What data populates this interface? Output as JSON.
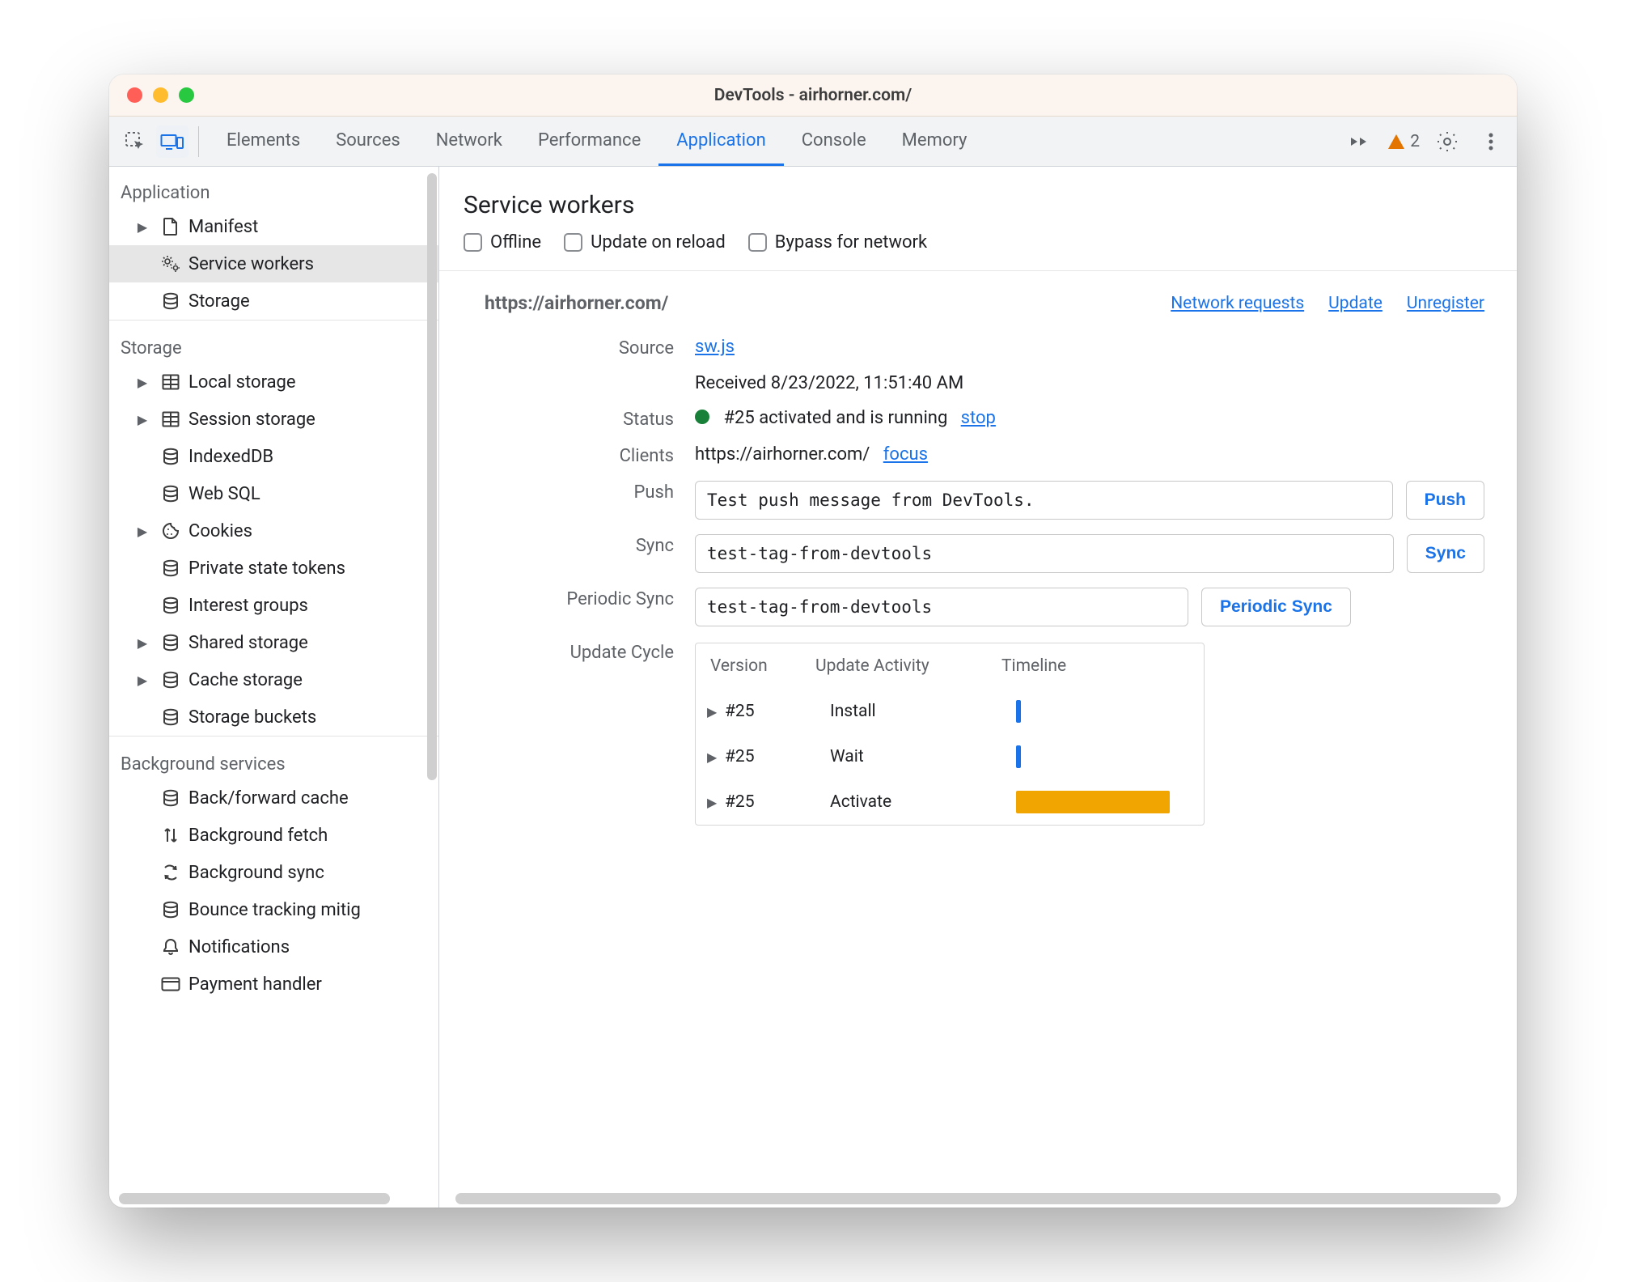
{
  "window_title": "DevTools - airhorner.com/",
  "toolbar": {
    "tabs": [
      "Elements",
      "Sources",
      "Network",
      "Performance",
      "Application",
      "Console",
      "Memory"
    ],
    "active_tab_index": 4,
    "warning_count": "2"
  },
  "sidebar": {
    "sections": [
      {
        "title": "Application",
        "items": [
          {
            "icon": "file-icon",
            "arrow": true,
            "label": "Manifest"
          },
          {
            "icon": "gears-icon",
            "arrow": false,
            "label": "Service workers",
            "selected": true
          },
          {
            "icon": "database-icon",
            "arrow": false,
            "label": "Storage"
          }
        ]
      },
      {
        "title": "Storage",
        "items": [
          {
            "icon": "table-icon",
            "arrow": true,
            "label": "Local storage"
          },
          {
            "icon": "table-icon",
            "arrow": true,
            "label": "Session storage"
          },
          {
            "icon": "database-icon",
            "arrow": false,
            "label": "IndexedDB"
          },
          {
            "icon": "database-icon",
            "arrow": false,
            "label": "Web SQL"
          },
          {
            "icon": "cookie-icon",
            "arrow": true,
            "label": "Cookies"
          },
          {
            "icon": "database-icon",
            "arrow": false,
            "label": "Private state tokens"
          },
          {
            "icon": "database-icon",
            "arrow": false,
            "label": "Interest groups"
          },
          {
            "icon": "database-icon",
            "arrow": true,
            "label": "Shared storage"
          },
          {
            "icon": "database-icon",
            "arrow": true,
            "label": "Cache storage"
          },
          {
            "icon": "database-icon",
            "arrow": false,
            "label": "Storage buckets"
          }
        ]
      },
      {
        "title": "Background services",
        "items": [
          {
            "icon": "database-icon",
            "arrow": false,
            "label": "Back/forward cache"
          },
          {
            "icon": "arrows-icon",
            "arrow": false,
            "label": "Background fetch"
          },
          {
            "icon": "sync-icon",
            "arrow": false,
            "label": "Background sync"
          },
          {
            "icon": "database-icon",
            "arrow": false,
            "label": "Bounce tracking mitig"
          },
          {
            "icon": "bell-icon",
            "arrow": false,
            "label": "Notifications"
          },
          {
            "icon": "card-icon",
            "arrow": false,
            "label": "Payment handler"
          }
        ]
      }
    ]
  },
  "main": {
    "title": "Service workers",
    "options": {
      "offline": "Offline",
      "update_on_reload": "Update on reload",
      "bypass_for_network": "Bypass for network"
    },
    "origin": "https://airhorner.com/",
    "origin_actions": {
      "network_requests": "Network requests",
      "update": "Update",
      "unregister": "Unregister"
    },
    "labels": {
      "source": "Source",
      "status": "Status",
      "clients": "Clients",
      "push": "Push",
      "sync": "Sync",
      "periodic_sync": "Periodic Sync",
      "update_cycle": "Update Cycle"
    },
    "source": {
      "file": "sw.js",
      "received": "Received 8/23/2022, 11:51:40 AM"
    },
    "status": {
      "text": "#25 activated and is running",
      "action": "stop"
    },
    "clients": {
      "url": "https://airhorner.com/",
      "action": "focus"
    },
    "push": {
      "value": "Test push message from DevTools.",
      "button": "Push"
    },
    "sync": {
      "value": "test-tag-from-devtools",
      "button": "Sync"
    },
    "periodic_sync": {
      "value": "test-tag-from-devtools",
      "button": "Periodic Sync"
    },
    "update_cycle": {
      "cols": {
        "version": "Version",
        "activity": "Update Activity",
        "timeline": "Timeline"
      },
      "rows": [
        {
          "version": "#25",
          "activity": "Install",
          "bar": "tiny"
        },
        {
          "version": "#25",
          "activity": "Wait",
          "bar": "tiny"
        },
        {
          "version": "#25",
          "activity": "Activate",
          "bar": "wide"
        }
      ]
    }
  },
  "icons_svg": {
    "file-icon": "<svg width='20' height='22' viewBox='0 0 20 22' fill='none' stroke='currentColor' stroke-width='2'><path d='M3 1h9l5 5v14a1 1 0 0 1-1 1H3a1 1 0 0 1-1-1V2a1 1 0 0 1 1-1Z'/><path d='M12 1v5h5'/></svg>",
    "gears-icon": "<svg width='24' height='22' viewBox='0 0 24 22' fill='none' stroke='currentColor' stroke-width='1.6'><circle cx='8' cy='8' r='3'/><path d='M8 3v-2M8 15v-2M3 8h-2M15 8h-2M4.5 4.5 3 3M13 13l-1.5-1.5M4.5 11.5 3 13M13 3l-1.5 1.5'/><circle cx='18' cy='16' r='2.5'/><path d='M18 12v-1.5M18 21v-1.5M14 16h-1.5M23 16h-1.5'/></svg>",
    "database-icon": "<svg width='22' height='22' viewBox='0 0 22 22' fill='none' stroke='currentColor' stroke-width='2'><ellipse cx='11' cy='5' rx='8' ry='3.2'/><path d='M3 5v12c0 1.8 3.6 3.2 8 3.2s8-1.4 8-3.2V5'/><path d='M3 11c0 1.8 3.6 3.2 8 3.2s8-1.4 8-3.2'/></svg>",
    "table-icon": "<svg width='22' height='20' viewBox='0 0 22 20' fill='none' stroke='currentColor' stroke-width='2'><rect x='1.5' y='1.5' width='19' height='17' rx='1'/><path d='M1.5 7h19M1.5 13h19M11 1.5v17'/></svg>",
    "cookie-icon": "<svg width='22' height='22' viewBox='0 0 22 22' fill='none' stroke='currentColor' stroke-width='2'><path d='M11 2a9 9 0 1 0 9 9 5 5 0 0 1-5-4 5 5 0 0 1-4-5Z'/><circle cx='8' cy='9' r='1' fill='currentColor' stroke='none'/><circle cx='12' cy='15' r='1' fill='currentColor' stroke='none'/><circle cx='7' cy='15' r='1' fill='currentColor' stroke='none'/></svg>",
    "arrows-icon": "<svg width='22' height='22' viewBox='0 0 22 22' fill='none' stroke='currentColor' stroke-width='2'><path d='M7 3v16M7 3 4 6M7 3l3 3'/><path d='M15 19V3M15 19l-3-3M15 19l3-3'/></svg>",
    "sync-icon": "<svg width='22' height='22' viewBox='0 0 22 22' fill='none' stroke='currentColor' stroke-width='2'><path d='M4 5a8 8 0 0 1 13 2'/><path d='m17 3 .5 4-4-.5'/><path d='M18 17a8 8 0 0 1-13-2'/><path d='m5 19-.5-4 4 .5'/></svg>",
    "bell-icon": "<svg width='20' height='22' viewBox='0 0 20 22' fill='none' stroke='currentColor' stroke-width='2'><path d='M10 2a6 6 0 0 1 6 6v4l2 3v1H2v-1l2-3V8a6 6 0 0 1 6-6Z'/><path d='M8 18a2 2 0 0 0 4 0'/></svg>",
    "card-icon": "<svg width='24' height='18' viewBox='0 0 24 18' fill='none' stroke='currentColor' stroke-width='2'><rect x='1.5' y='1.5' width='21' height='15' rx='2'/><path d='M1.5 6h21'/></svg>",
    "inspect-icon": "<svg width='26' height='26' viewBox='0 0 26 26' fill='none' stroke='currentColor' stroke-width='2'><rect x='2' y='2' width='16' height='16' rx='2' stroke-dasharray='3 3'/><path d='m12 12 11 4-4 2-2 4-5-10Z' fill='currentColor' stroke='none'/></svg>",
    "device-icon": "<svg width='30' height='22' viewBox='0 0 30 22' fill='none' stroke='currentColor' stroke-width='2'><rect x='1.5' y='3' width='18' height='13' rx='1'/><path d='M7 20h8'/><rect x='21' y='6' width='7' height='13' rx='1'/></svg>",
    "more-icon": "<svg width='28' height='22' viewBox='0 0 28 22' fill='currentColor'><path d='m3 6 8 5-8 5V6ZM14 6l8 5-8 5V6Z'/></svg>",
    "warn-icon": "<svg width='22' height='20' viewBox='0 0 22 20' fill='currentColor'><path d='M11 1 21 19H1L11 1Z'/></svg>",
    "gear-icon": "<svg width='26' height='26' viewBox='0 0 26 26' fill='none' stroke='currentColor' stroke-width='2'><circle cx='13' cy='13' r='4'/><path d='M13 3V1M13 25v-2M3 13H1M25 13h-2M5.5 5.5 4 4M22 22l-1.5-1.5M5.5 20.5 4 22M22 4l-1.5 1.5'/></svg>",
    "kebab-icon": "<svg width='8' height='24' viewBox='0 0 8 24' fill='currentColor'><circle cx='4' cy='4' r='2.5'/><circle cx='4' cy='12' r='2.5'/><circle cx='4' cy='20' r='2.5'/></svg>"
  }
}
